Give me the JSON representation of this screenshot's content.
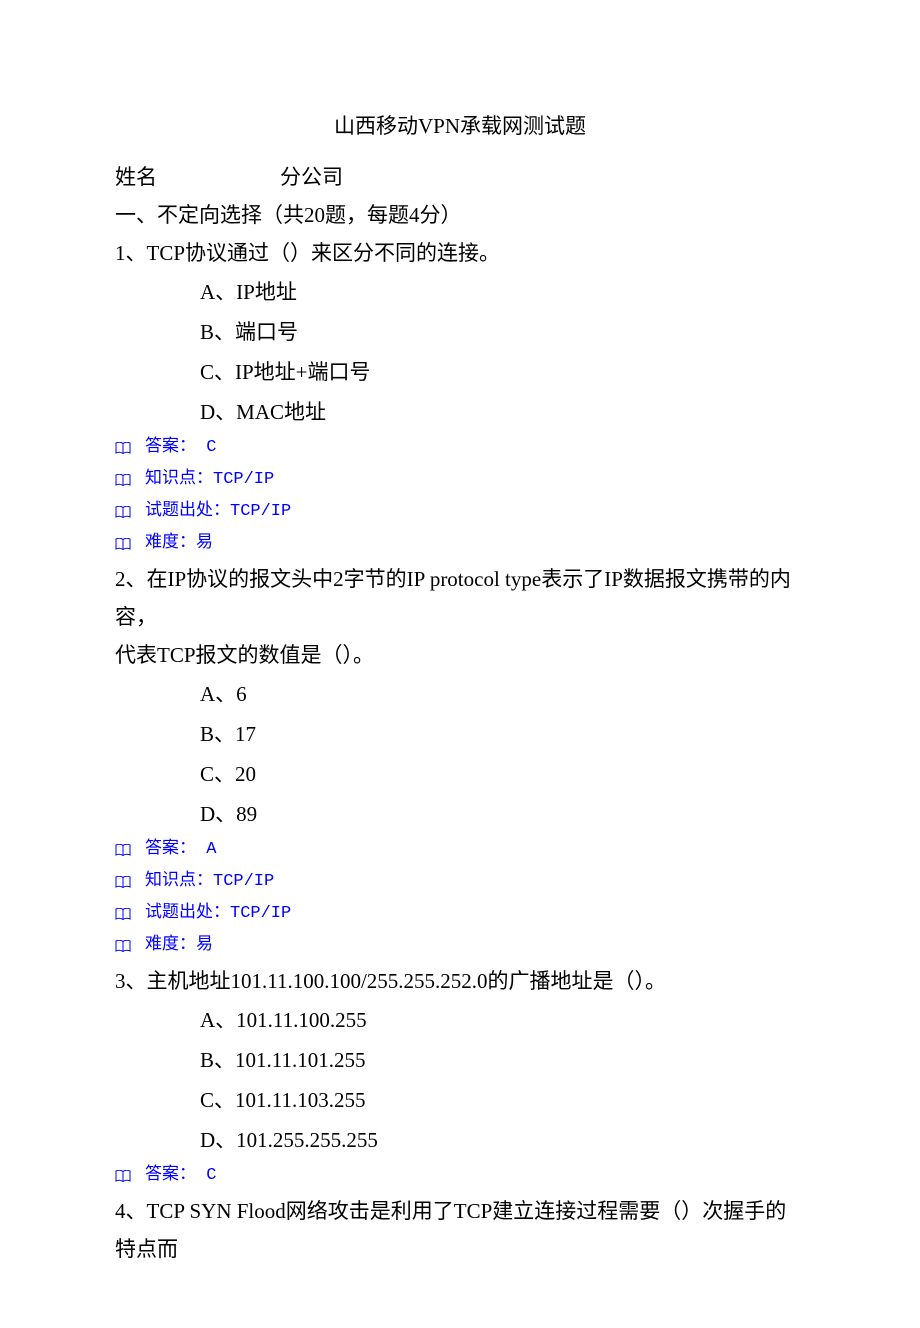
{
  "title": "山西移动VPN承载网测试题",
  "header": {
    "name_label": "姓名",
    "branch_label": "分公司"
  },
  "section1_heading": "一、不定向选择（共20题，每题4分）",
  "questions": [
    {
      "stem": "1、TCP协议通过（）来区分不同的连接。",
      "options": {
        "A": "A、IP地址",
        "B": "B、端口号",
        "C": "C、IP地址+端口号",
        "D": "D、MAC地址"
      },
      "meta": {
        "answer": "答案： C",
        "knowledge": "知识点：TCP/IP",
        "source": "试题出处：TCP/IP",
        "difficulty": "难度：易"
      }
    },
    {
      "stem": "2、在IP协议的报文头中2字节的IP protocol type表示了IP数据报文携带的内容，",
      "stem_line2": "代表TCP报文的数值是（）。",
      "options": {
        "A": "A、6",
        "B": "B、17",
        "C": "C、20",
        "D": "D、89"
      },
      "meta": {
        "answer": "答案： A",
        "knowledge": "知识点：TCP/IP",
        "source": "试题出处：TCP/IP",
        "difficulty": "难度：易"
      }
    },
    {
      "stem": "3、主机地址101.11.100.100/255.255.252.0的广播地址是（）。",
      "options": {
        "A": "A、101.11.100.255",
        "B": "B、101.11.101.255",
        "C": "C、101.11.103.255",
        "D": "D、101.255.255.255"
      },
      "meta": {
        "answer": "答案： C"
      }
    },
    {
      "stem": "4、TCP SYN Flood网络攻击是利用了TCP建立连接过程需要（）次握手的特点而"
    }
  ]
}
